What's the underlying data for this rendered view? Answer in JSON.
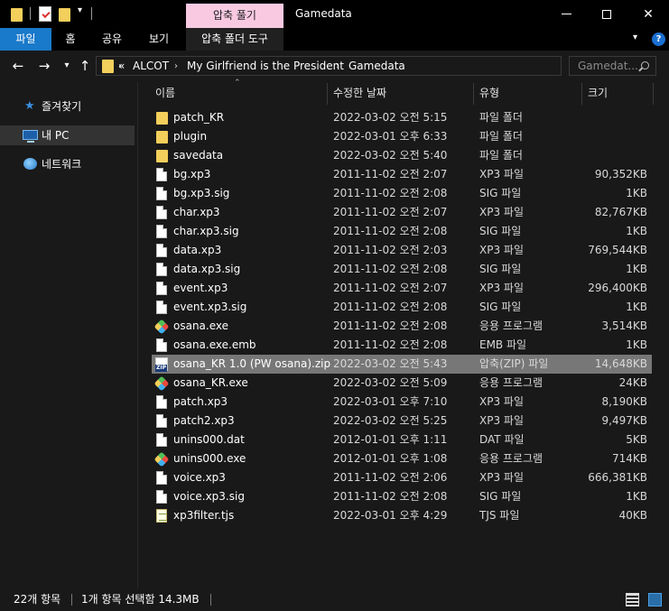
{
  "window": {
    "title": "Gamedata",
    "context_tab": "압축 풀기"
  },
  "ribbon": {
    "tabs": [
      "파일",
      "홈",
      "공유",
      "보기"
    ],
    "context_tab": "압축 폴더 도구"
  },
  "address": {
    "overflow": "«",
    "crumbs": [
      "ALCOT",
      "My Girlfriend is the President",
      "Gamedata"
    ],
    "search_placeholder": "Gamedat..."
  },
  "sidebar": {
    "items": [
      {
        "label": "즐겨찾기",
        "icon": "star-icon"
      },
      {
        "label": "내 PC",
        "icon": "computer-icon"
      },
      {
        "label": "네트워크",
        "icon": "network-icon"
      }
    ]
  },
  "columns": {
    "name": "이름",
    "date": "수정한 날짜",
    "type": "유형",
    "size": "크기"
  },
  "files": [
    {
      "name": "patch_KR",
      "date": "2022-03-02 오전 5:15",
      "type": "파일 폴더",
      "size": "",
      "icon": "folder"
    },
    {
      "name": "plugin",
      "date": "2022-03-01 오후 6:33",
      "type": "파일 폴더",
      "size": "",
      "icon": "folder"
    },
    {
      "name": "savedata",
      "date": "2022-03-02 오전 5:40",
      "type": "파일 폴더",
      "size": "",
      "icon": "folder"
    },
    {
      "name": "bg.xp3",
      "date": "2011-11-02 오전 2:07",
      "type": "XP3 파일",
      "size": "90,352KB",
      "icon": "doc"
    },
    {
      "name": "bg.xp3.sig",
      "date": "2011-11-02 오전 2:08",
      "type": "SIG 파일",
      "size": "1KB",
      "icon": "doc"
    },
    {
      "name": "char.xp3",
      "date": "2011-11-02 오전 2:07",
      "type": "XP3 파일",
      "size": "82,767KB",
      "icon": "doc"
    },
    {
      "name": "char.xp3.sig",
      "date": "2011-11-02 오전 2:08",
      "type": "SIG 파일",
      "size": "1KB",
      "icon": "doc"
    },
    {
      "name": "data.xp3",
      "date": "2011-11-02 오전 2:03",
      "type": "XP3 파일",
      "size": "769,544KB",
      "icon": "doc"
    },
    {
      "name": "data.xp3.sig",
      "date": "2011-11-02 오전 2:08",
      "type": "SIG 파일",
      "size": "1KB",
      "icon": "doc"
    },
    {
      "name": "event.xp3",
      "date": "2011-11-02 오전 2:07",
      "type": "XP3 파일",
      "size": "296,400KB",
      "icon": "doc"
    },
    {
      "name": "event.xp3.sig",
      "date": "2011-11-02 오전 2:08",
      "type": "SIG 파일",
      "size": "1KB",
      "icon": "doc"
    },
    {
      "name": "osana.exe",
      "date": "2011-11-02 오전 2:08",
      "type": "응용 프로그램",
      "size": "3,514KB",
      "icon": "exe"
    },
    {
      "name": "osana.exe.emb",
      "date": "2011-11-02 오전 2:08",
      "type": "EMB 파일",
      "size": "1KB",
      "icon": "doc"
    },
    {
      "name": "osana_KR 1.0 (PW osana).zip",
      "date": "2022-03-02 오전 5:43",
      "type": "압축(ZIP) 파일",
      "size": "14,648KB",
      "icon": "zip",
      "selected": true
    },
    {
      "name": "osana_KR.exe",
      "date": "2022-03-02 오전 5:09",
      "type": "응용 프로그램",
      "size": "24KB",
      "icon": "exe"
    },
    {
      "name": "patch.xp3",
      "date": "2022-03-01 오후 7:10",
      "type": "XP3 파일",
      "size": "8,190KB",
      "icon": "doc"
    },
    {
      "name": "patch2.xp3",
      "date": "2022-03-02 오전 5:25",
      "type": "XP3 파일",
      "size": "9,497KB",
      "icon": "doc"
    },
    {
      "name": "unins000.dat",
      "date": "2012-01-01 오후 1:11",
      "type": "DAT 파일",
      "size": "5KB",
      "icon": "doc"
    },
    {
      "name": "unins000.exe",
      "date": "2012-01-01 오후 1:08",
      "type": "응용 프로그램",
      "size": "714KB",
      "icon": "exe"
    },
    {
      "name": "voice.xp3",
      "date": "2011-11-02 오전 2:06",
      "type": "XP3 파일",
      "size": "666,381KB",
      "icon": "doc"
    },
    {
      "name": "voice.xp3.sig",
      "date": "2011-11-02 오전 2:08",
      "type": "SIG 파일",
      "size": "1KB",
      "icon": "doc"
    },
    {
      "name": "xp3filter.tjs",
      "date": "2022-03-01 오후 4:29",
      "type": "TJS 파일",
      "size": "40KB",
      "icon": "tjs"
    }
  ],
  "status": {
    "item_count": "22개 항목",
    "selection": "1개 항목 선택함 14.3MB"
  }
}
